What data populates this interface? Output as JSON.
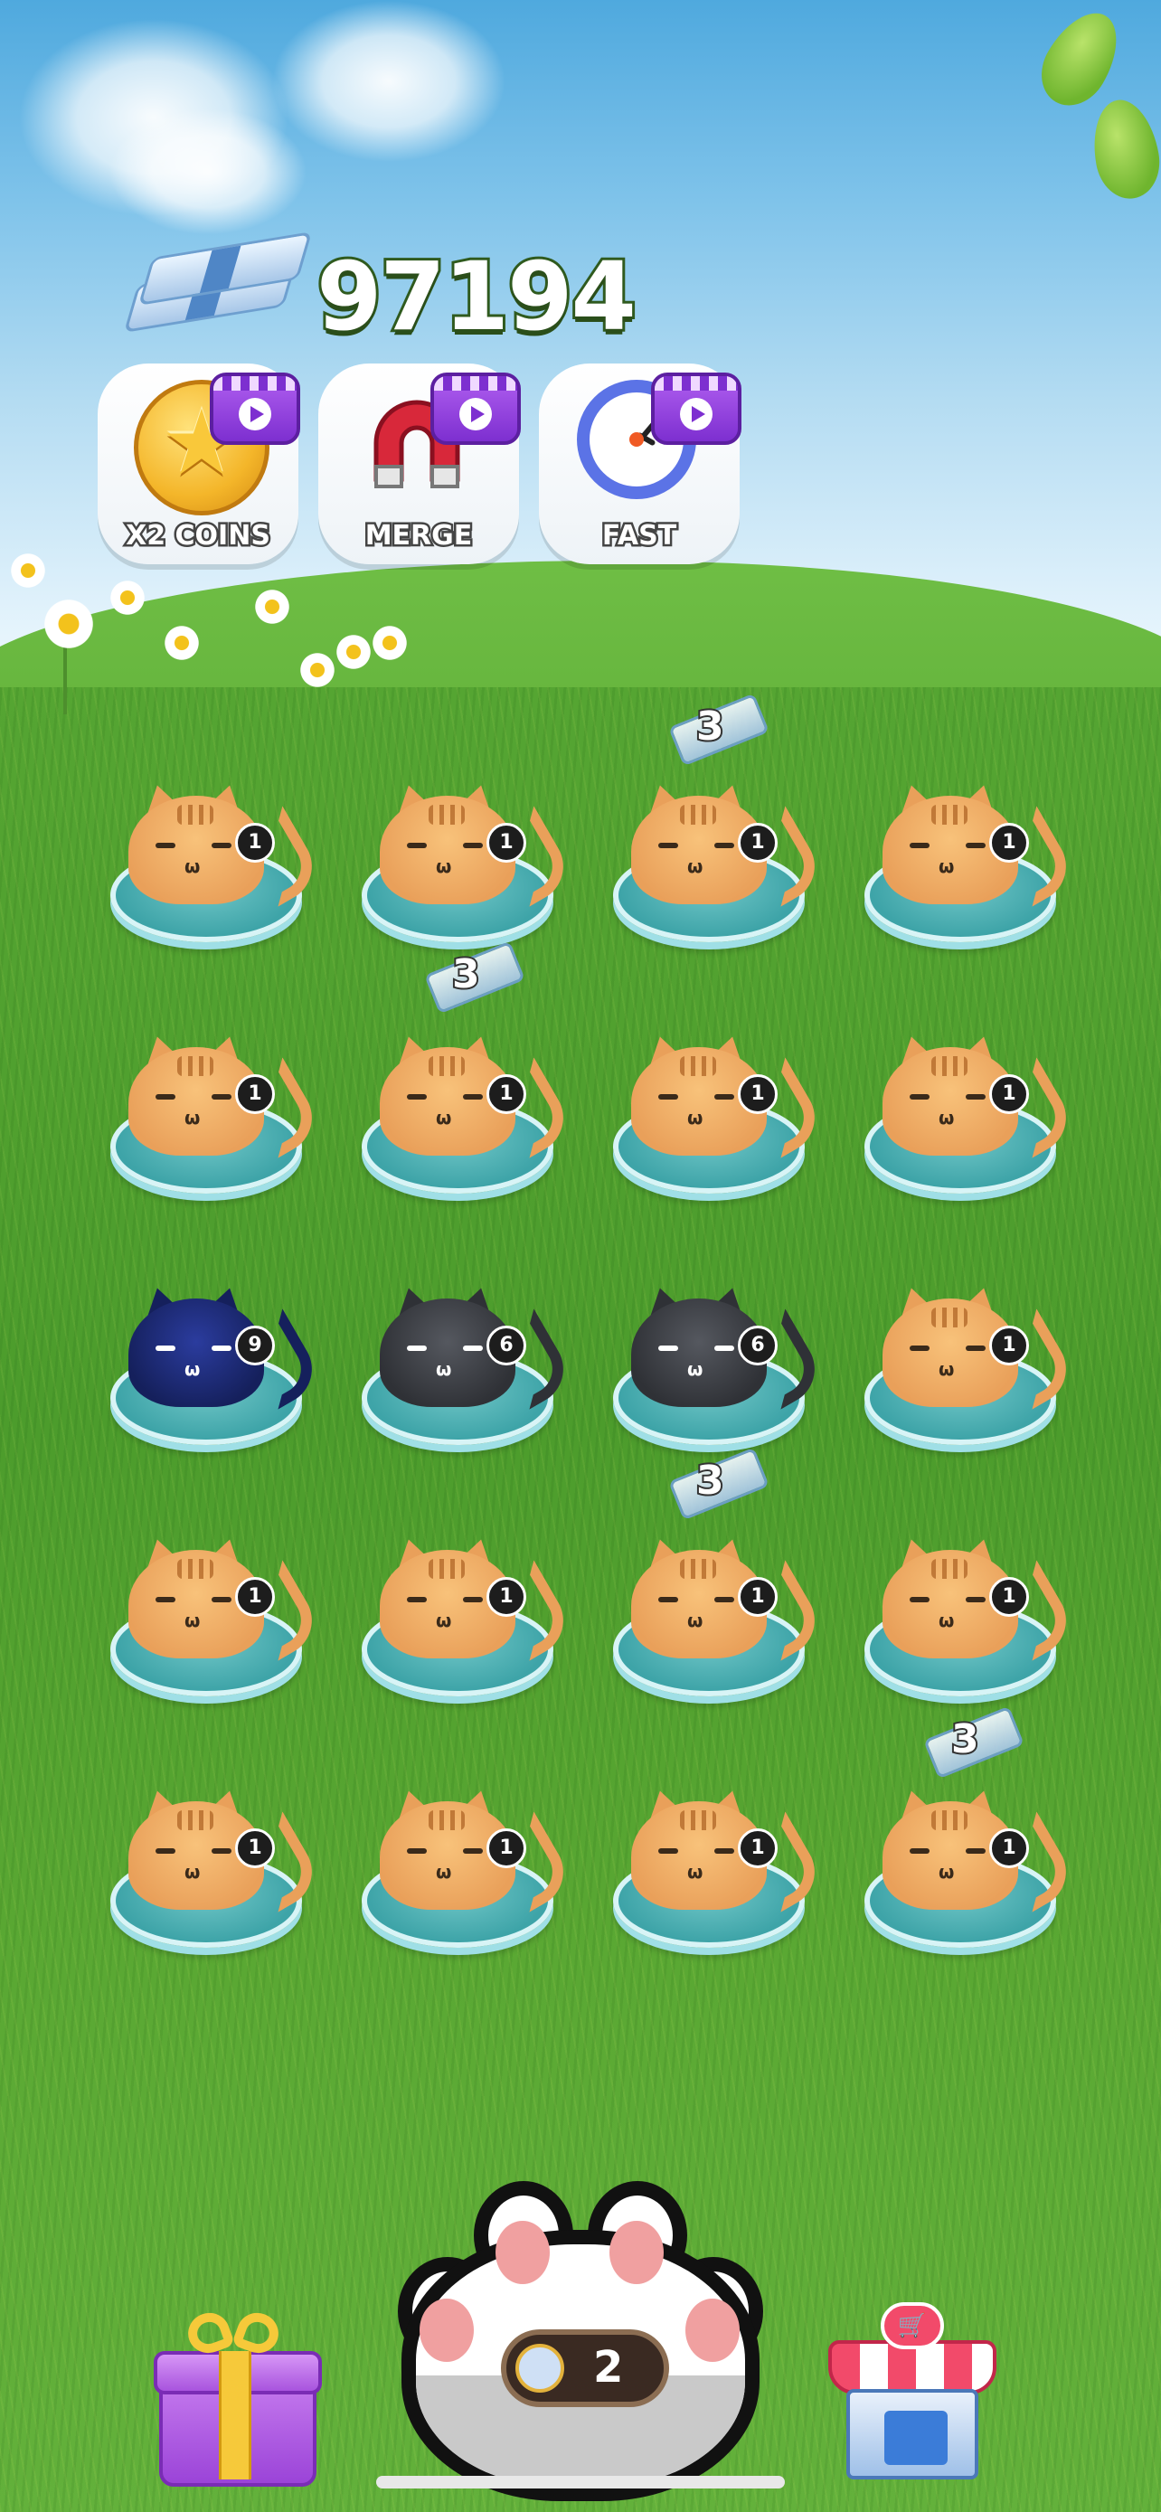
{
  "coins": {
    "value": "97194"
  },
  "boosters": [
    {
      "label": "X2 COINS",
      "icon": "star-coin-icon"
    },
    {
      "label": "MERGE",
      "icon": "magnet-icon"
    },
    {
      "label": "FAST",
      "icon": "clock-icon"
    }
  ],
  "grid": {
    "rows": [
      [
        {
          "level": "1",
          "kind": "orange",
          "bonus": ""
        },
        {
          "level": "1",
          "kind": "orange",
          "bonus": ""
        },
        {
          "level": "1",
          "kind": "orange",
          "bonus": "3"
        },
        {
          "level": "1",
          "kind": "orange",
          "bonus": ""
        }
      ],
      [
        {
          "level": "1",
          "kind": "orange",
          "bonus": ""
        },
        {
          "level": "1",
          "kind": "orange",
          "bonus": "3"
        },
        {
          "level": "1",
          "kind": "orange",
          "bonus": ""
        },
        {
          "level": "1",
          "kind": "orange",
          "bonus": ""
        }
      ],
      [
        {
          "level": "9",
          "kind": "navy",
          "bonus": ""
        },
        {
          "level": "6",
          "kind": "black",
          "bonus": ""
        },
        {
          "level": "6",
          "kind": "black",
          "bonus": ""
        },
        {
          "level": "1",
          "kind": "orange",
          "bonus": ""
        }
      ],
      [
        {
          "level": "1",
          "kind": "orange",
          "bonus": ""
        },
        {
          "level": "1",
          "kind": "orange",
          "bonus": ""
        },
        {
          "level": "1",
          "kind": "orange",
          "bonus": "3"
        },
        {
          "level": "1",
          "kind": "orange",
          "bonus": ""
        }
      ],
      [
        {
          "level": "1",
          "kind": "orange",
          "bonus": ""
        },
        {
          "level": "1",
          "kind": "orange",
          "bonus": ""
        },
        {
          "level": "1",
          "kind": "orange",
          "bonus": ""
        },
        {
          "level": "1",
          "kind": "orange",
          "bonus": "3"
        }
      ]
    ]
  },
  "bottom": {
    "gift_icon": "gift-icon",
    "paw_icon": "paw-button-icon",
    "timer_value": "2",
    "shop_icon": "shop-icon",
    "shop_glyph": "🛒"
  }
}
